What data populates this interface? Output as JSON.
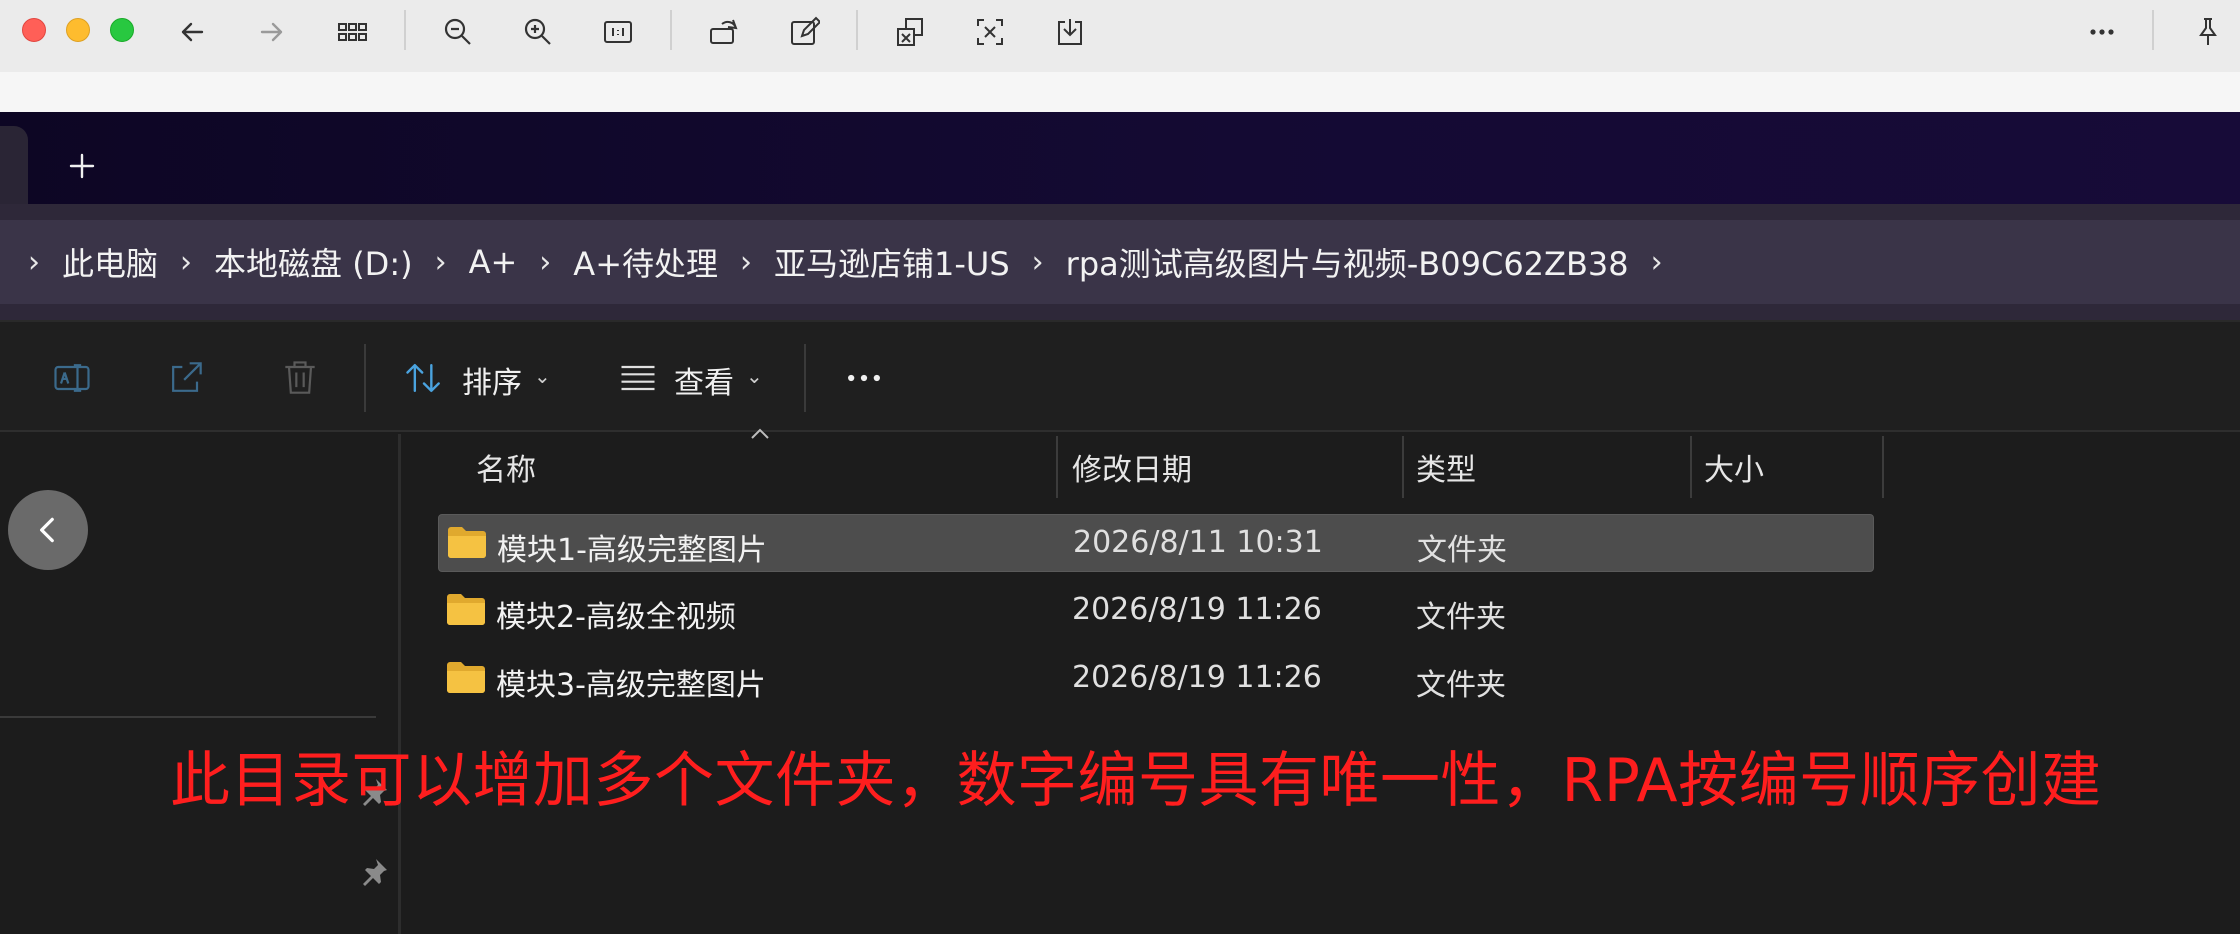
{
  "breadcrumb": {
    "items": [
      "此电脑",
      "本地磁盘 (D:)",
      "A+",
      "A+待处理",
      "亚马逊店铺1-US",
      "rpa测试高级图片与视频-B09C62ZB38"
    ]
  },
  "command_bar": {
    "sort_label": "排序",
    "view_label": "查看"
  },
  "columns": {
    "name": "名称",
    "modified": "修改日期",
    "type": "类型",
    "size": "大小"
  },
  "files": [
    {
      "name": "模块1-高级完整图片",
      "modified": "2026/8/11 10:31",
      "type": "文件夹",
      "selected": true
    },
    {
      "name": "模块2-高级全视频",
      "modified": "2026/8/19 11:26",
      "type": "文件夹",
      "selected": false
    },
    {
      "name": "模块3-高级完整图片",
      "modified": "2026/8/19 11:26",
      "type": "文件夹",
      "selected": false
    }
  ],
  "annotation": "此目录可以增加多个文件夹，数字编号具有唯一性，RPA按编号顺序创建",
  "colors": {
    "annotation": "#ff1e1e",
    "folder": "#f5c242",
    "accent_icon": "#4aa3df"
  },
  "icons": [
    "back-arrow-icon",
    "forward-arrow-icon",
    "grid-icon",
    "zoom-out-icon",
    "zoom-in-icon",
    "actual-size-icon",
    "rotate-icon",
    "edit-icon",
    "translate-icon",
    "ocr-icon",
    "download-icon",
    "more-icon",
    "pin-icon",
    "plus-icon",
    "rename-icon",
    "share-icon",
    "delete-icon",
    "sort-icon",
    "view-icon",
    "folder-icon"
  ]
}
